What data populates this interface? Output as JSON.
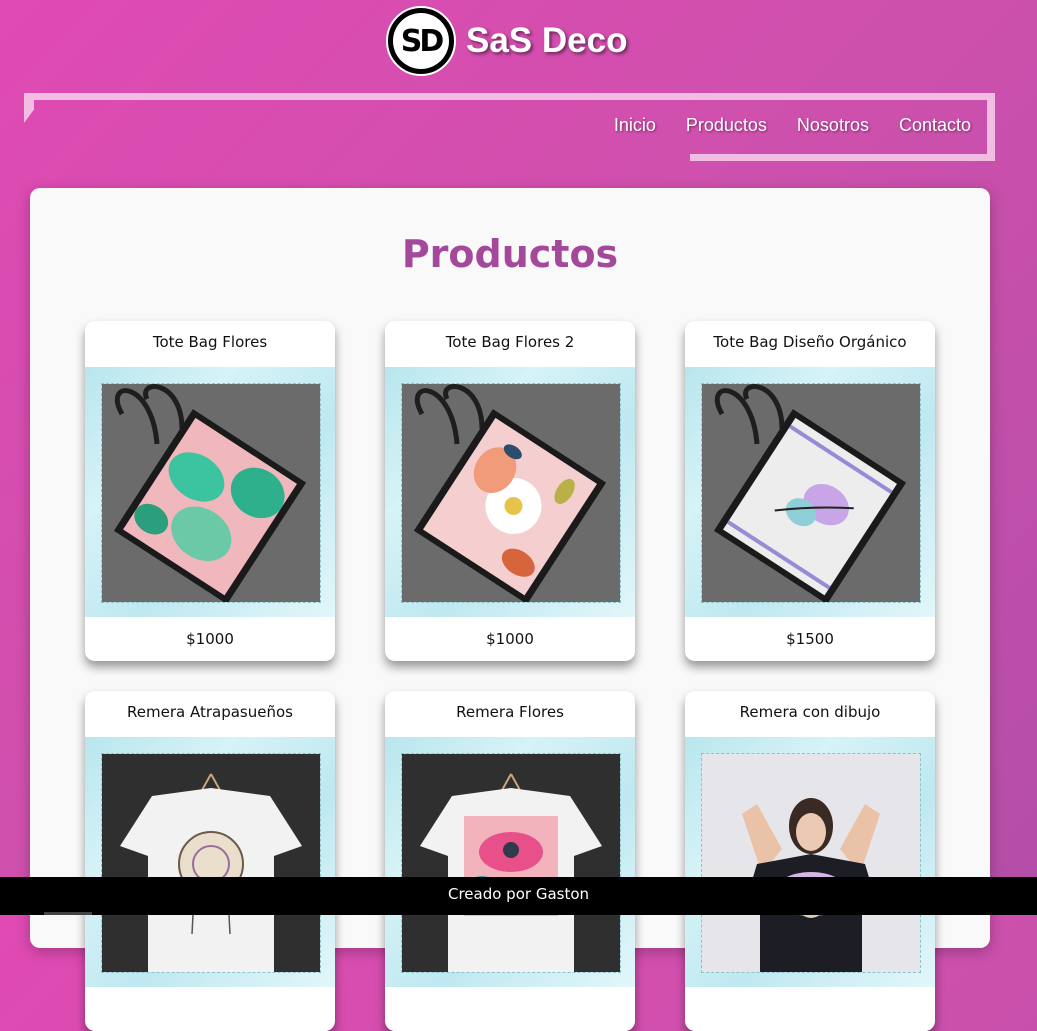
{
  "brand": {
    "logo_text": "SD",
    "name": "SaS Deco"
  },
  "nav": {
    "items": [
      "Inicio",
      "Productos",
      "Nosotros",
      "Contacto"
    ]
  },
  "main": {
    "title": "Productos"
  },
  "products": [
    {
      "title": "Tote Bag Flores",
      "price": "$1000"
    },
    {
      "title": "Tote Bag Flores 2",
      "price": "$1000"
    },
    {
      "title": "Tote Bag Diseño Orgánico",
      "price": "$1500"
    },
    {
      "title": "Remera Atrapasueños",
      "price": ""
    },
    {
      "title": "Remera Flores",
      "price": ""
    },
    {
      "title": "Remera con dibujo",
      "price": ""
    }
  ],
  "footer": {
    "text": "Creado por Gaston"
  },
  "colors": {
    "background": "#d84fb0",
    "title": "#a3489b",
    "nav_frame": "#f2bde2",
    "footer": "#000000"
  }
}
